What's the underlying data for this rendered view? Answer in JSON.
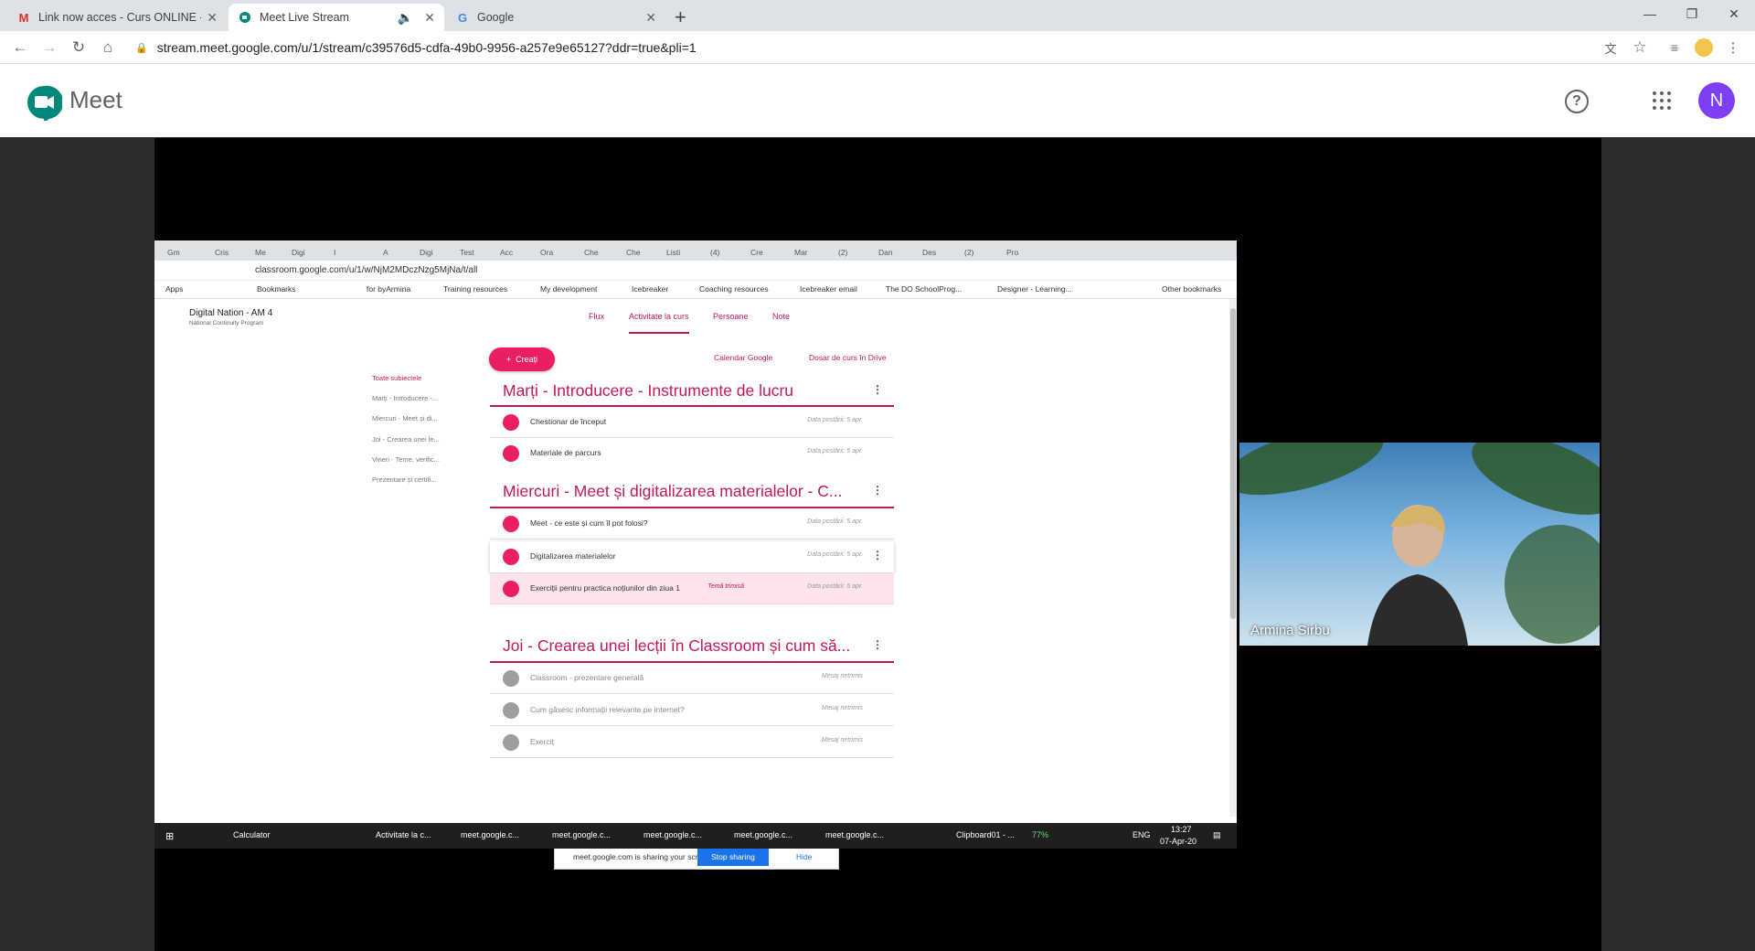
{
  "browser": {
    "tabs": [
      {
        "title": "Link now acces - Curs ONLINE - ",
        "icon": "gmail-icon"
      },
      {
        "title": "Meet Live Stream",
        "icon": "meet-icon"
      },
      {
        "title": "Google",
        "icon": "google-icon"
      }
    ],
    "url": "stream.meet.google.com/u/1/stream/c39576d5-cdfa-49b0-9956-a257e9e65127?ddr=true&pli=1"
  },
  "meet": {
    "brand": "Meet",
    "avatar_initial": "N",
    "participant_name": "Armina Sirbu"
  },
  "shared_screen": {
    "tabs": [
      "Gm",
      "Cris",
      "Me",
      "Digi",
      "I",
      "A",
      "Digi",
      "Test",
      "Acc",
      "Ora",
      "Che",
      "Che",
      "Listi",
      "(4)",
      "Cre",
      "Mar",
      "(2)",
      "Dan",
      "Des",
      "(2)",
      "Pro"
    ],
    "url": "classroom.google.com/u/1/w/NjM2MDczNzg5MjNa/t/all",
    "bookmarks": [
      "Apps",
      "Bookmarks",
      "for byArmina",
      "Training resources",
      "My development",
      "Icebreaker",
      "Coaching resources",
      "Icebreaker email",
      "The DO SchoolProg...",
      "Designer - Learning...",
      "Other bookmarks"
    ],
    "class_name": "Digital Nation - AM 4",
    "class_sub": "National Continuity Program",
    "nav": [
      "Flux",
      "Activitate la curs",
      "Persoane",
      "Note"
    ],
    "create_label": "Creați",
    "calendar_link": "Calendar Google",
    "drive_link": "Dosar de curs în Drive",
    "topics": [
      "Toate subiectele",
      "Marți - Introducere -...",
      "Miercuri - Meet și di...",
      "Joi - Crearea unei le...",
      "Vineri - Teme, verific...",
      "Prezentare și certifi..."
    ],
    "sections": [
      {
        "title": "Marți - Introducere - Instrumente de lucru",
        "items": [
          {
            "title": "Chestionar de început",
            "date": "Data postării: 5 apr."
          },
          {
            "title": "Materiale de parcurs",
            "date": "Data postării: 5 apr."
          }
        ]
      },
      {
        "title": "Miercuri - Meet și digitalizarea materialelor - C...",
        "items": [
          {
            "title": "Meet - ce este și cum îl pot folosi?",
            "date": "Data postării: 5 apr."
          },
          {
            "title": "Digitalizarea materialelor",
            "date": "Data postării: 5 apr."
          },
          {
            "title": "Exerciții pentru practica noțiunilor din ziua 1",
            "date": "Data postării: 5 apr.",
            "extra": "Temă trimisă"
          }
        ]
      },
      {
        "title": "Joi - Crearea unei lecții în Classroom și cum să...",
        "items": [
          {
            "title": "Classroom - prezentare generală",
            "date": "Mesaj netrimis"
          },
          {
            "title": "Cum găsesc informații relevante pe internet?",
            "date": "Mesaj netrimis"
          },
          {
            "title": "Exerciț",
            "date": "Mesaj netrimis"
          }
        ]
      }
    ],
    "share_message": "meet.google.com is sharing your screen.",
    "stop_sharing": "Stop sharing",
    "hide": "Hide",
    "taskbar": [
      "Calculator",
      "Activitate la c...",
      "meet.google.c...",
      "meet.google.c...",
      "meet.google.c...",
      "meet.google.c...",
      "meet.google.c...",
      "Clipboard01 - ..."
    ],
    "battery": "77%",
    "lang": "ENG",
    "time": "13:27",
    "date": "07-Apr-20"
  },
  "colors": {
    "classroom_accent": "#c2185b",
    "meet_avatar": "#7e3ff2",
    "stop_sharing": "#1a73e8"
  }
}
